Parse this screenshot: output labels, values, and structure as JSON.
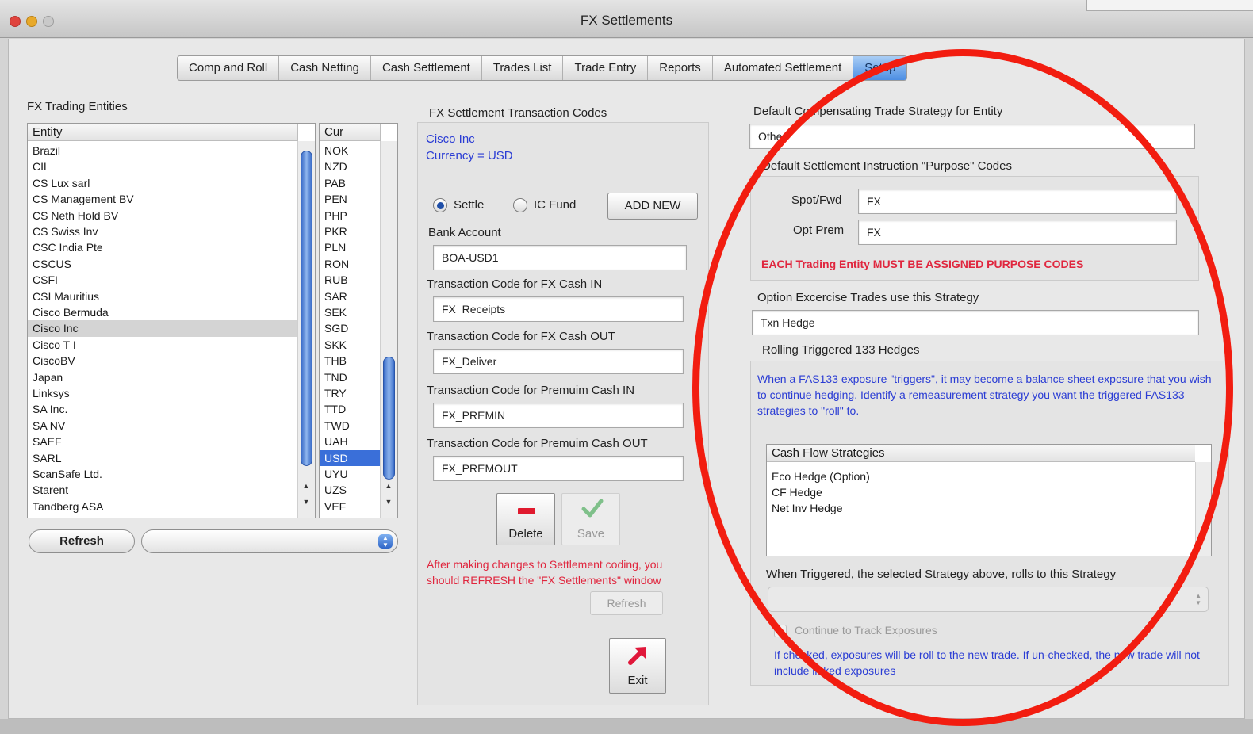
{
  "window": {
    "title": "FX Settlements"
  },
  "tabs": [
    {
      "label": "Comp and Roll"
    },
    {
      "label": "Cash Netting"
    },
    {
      "label": "Cash Settlement"
    },
    {
      "label": "Trades List"
    },
    {
      "label": "Trade Entry"
    },
    {
      "label": "Reports"
    },
    {
      "label": "Automated Settlement"
    },
    {
      "label": "Setup"
    }
  ],
  "entities_panel": {
    "title": "FX Trading Entities",
    "entity_header": "Entity",
    "currency_header": "Cur",
    "entities": [
      "Brazil",
      "CIL",
      "CS Lux sarl",
      "CS Management BV",
      "CS Neth Hold BV",
      "CS Swiss Inv",
      "CSC India Pte",
      "CSCUS",
      "CSFI",
      "CSI Mauritius",
      "Cisco Bermuda",
      "Cisco Inc",
      "Cisco T I",
      "CiscoBV",
      "Japan",
      "Linksys",
      "SA Inc.",
      "SA NV",
      "SAEF",
      "SARL",
      "ScanSafe Ltd.",
      "Starent",
      "Tandberg ASA"
    ],
    "selected_entity": "Cisco Inc",
    "currencies": [
      "NOK",
      "NZD",
      "PAB",
      "PEN",
      "PHP",
      "PKR",
      "PLN",
      "RON",
      "RUB",
      "SAR",
      "SEK",
      "SGD",
      "SKK",
      "THB",
      "TND",
      "TRY",
      "TTD",
      "TWD",
      "UAH",
      "USD",
      "UYU",
      "UZS",
      "VEF"
    ],
    "selected_currency": "USD",
    "refresh_label": "Refresh",
    "popup_value": ""
  },
  "txn_codes": {
    "title": "FX Settlement Transaction Codes",
    "entity_line": "Cisco Inc",
    "currency_line": "Currency = USD",
    "settle_label": "Settle",
    "ic_fund_label": "IC Fund",
    "add_new_label": "ADD NEW",
    "bank_account_label": "Bank Account",
    "bank_account_value": "BOA-USD1",
    "cash_in_label": "Transaction Code for FX Cash IN",
    "cash_in_value": "FX_Receipts",
    "cash_out_label": "Transaction Code for FX Cash OUT",
    "cash_out_value": "FX_Deliver",
    "prem_in_label": "Transaction Code for Premuim Cash IN",
    "prem_in_value": "FX_PREMIN",
    "prem_out_label": "Transaction Code for Premuim Cash OUT",
    "prem_out_value": "FX_PREMOUT",
    "delete_label": "Delete",
    "save_label": "Save",
    "note": "After making changes to Settlement coding, you should REFRESH the \"FX Settlements\" window",
    "refresh_label": "Refresh",
    "exit_label": "Exit"
  },
  "strategy": {
    "default_comp_label": "Default Compensating Trade Strategy for Entity",
    "default_comp_value": "Other",
    "purpose_codes_label": "Default Settlement Instruction \"Purpose\" Codes",
    "spot_fwd_label": "Spot/Fwd",
    "spot_fwd_value": "FX",
    "opt_prem_label": "Opt Prem",
    "opt_prem_value": "FX",
    "purpose_warning": "EACH Trading Entity MUST BE ASSIGNED PURPOSE CODES",
    "option_exercise_label": "Option Excercise Trades use this Strategy",
    "option_exercise_value": "Txn Hedge",
    "rolling_title": "Rolling Triggered 133 Hedges",
    "rolling_desc": "When a FAS133 exposure \"triggers\", it may become a balance sheet exposure that you wish to continue hedging.  Identify a remeasurement strategy you want the triggered FAS133 strategies to \"roll\" to.",
    "cash_flow_header": "Cash Flow Strategies",
    "cash_flow_items": [
      "Eco Hedge (Option)",
      "CF Hedge",
      "Net Inv Hedge"
    ],
    "rolls_to_label": "When Triggered, the selected Strategy above, rolls to this Strategy",
    "rolls_to_value": "",
    "continue_label": "Continue to Track Exposures",
    "continue_desc": "If checked, exposures will be roll to the new trade.  If un-checked, the new trade will not include linked exposures"
  },
  "colors": {
    "annotation_circle": "#f21d10",
    "selection": "#3a6fd9",
    "warning": "#e0263e",
    "info_text": "#2a3cd4"
  }
}
